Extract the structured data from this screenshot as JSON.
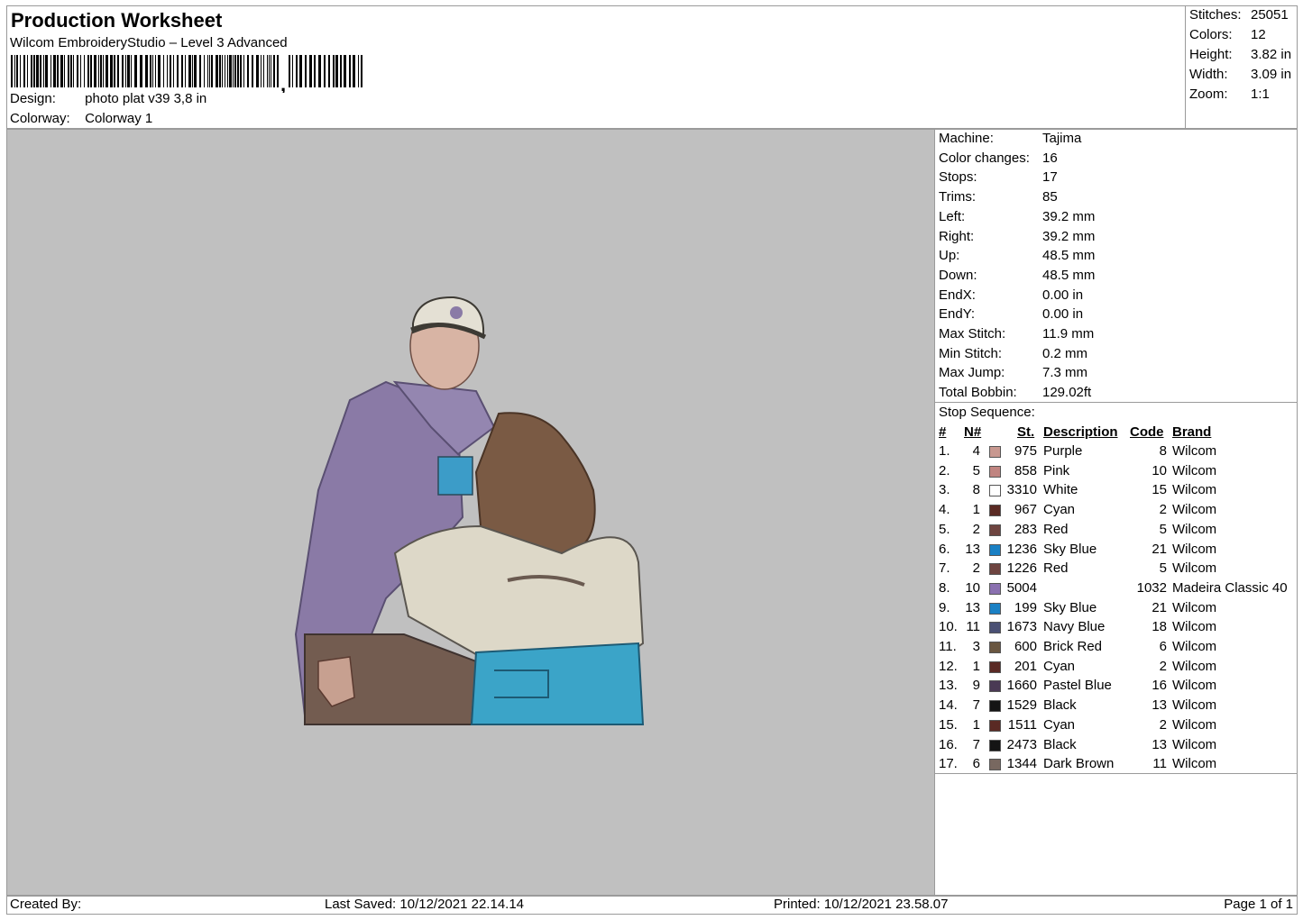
{
  "header": {
    "title": "Production Worksheet",
    "software": "Wilcom EmbroideryStudio – Level 3 Advanced",
    "design_label": "Design:",
    "design_value": "photo plat v39 3,8 in",
    "colorway_label": "Colorway:",
    "colorway_value": "Colorway 1"
  },
  "stats": [
    {
      "label": "Stitches:",
      "value": "25051"
    },
    {
      "label": "Colors:",
      "value": "12"
    },
    {
      "label": "Height:",
      "value": "3.82 in"
    },
    {
      "label": "Width:",
      "value": "3.09 in"
    },
    {
      "label": "Zoom:",
      "value": "1:1"
    }
  ],
  "machine_info": [
    {
      "label": "Machine:",
      "value": "Tajima"
    },
    {
      "label": "Color changes:",
      "value": "16"
    },
    {
      "label": "Stops:",
      "value": "17"
    },
    {
      "label": "Trims:",
      "value": "85"
    },
    {
      "label": "Left:",
      "value": "39.2 mm"
    },
    {
      "label": "Right:",
      "value": "39.2 mm"
    },
    {
      "label": "Up:",
      "value": "48.5 mm"
    },
    {
      "label": "Down:",
      "value": "48.5 mm"
    },
    {
      "label": "EndX:",
      "value": "0.00 in"
    },
    {
      "label": "EndY:",
      "value": "0.00 in"
    },
    {
      "label": "Max Stitch:",
      "value": "11.9 mm"
    },
    {
      "label": "Min Stitch:",
      "value": "0.2 mm"
    },
    {
      "label": "Max Jump:",
      "value": "7.3 mm"
    },
    {
      "label": "Total Bobbin:",
      "value": "129.02ft"
    }
  ],
  "stop_sequence": {
    "label": "Stop Sequence:",
    "headers": {
      "idx": "#",
      "n": "N#",
      "st": "St.",
      "desc": "Description",
      "code": "Code",
      "brand": "Brand"
    },
    "rows": [
      {
        "idx": "1.",
        "n": "4",
        "color": "#c89890",
        "st": "975",
        "desc": "Purple",
        "code": "8",
        "brand": "Wilcom"
      },
      {
        "idx": "2.",
        "n": "5",
        "color": "#c08480",
        "st": "858",
        "desc": "Pink",
        "code": "10",
        "brand": "Wilcom"
      },
      {
        "idx": "3.",
        "n": "8",
        "color": "#ffffff",
        "st": "3310",
        "desc": "White",
        "code": "15",
        "brand": "Wilcom"
      },
      {
        "idx": "4.",
        "n": "1",
        "color": "#5a2a24",
        "st": "967",
        "desc": "Cyan",
        "code": "2",
        "brand": "Wilcom"
      },
      {
        "idx": "5.",
        "n": "2",
        "color": "#6e4440",
        "st": "283",
        "desc": "Red",
        "code": "5",
        "brand": "Wilcom"
      },
      {
        "idx": "6.",
        "n": "13",
        "color": "#1a80c4",
        "st": "1236",
        "desc": "Sky Blue",
        "code": "21",
        "brand": "Wilcom"
      },
      {
        "idx": "7.",
        "n": "2",
        "color": "#6e4440",
        "st": "1226",
        "desc": "Red",
        "code": "5",
        "brand": "Wilcom"
      },
      {
        "idx": "8.",
        "n": "10",
        "color": "#8a70b0",
        "st": "5004",
        "desc": "",
        "code": "1032",
        "brand": "Madeira Classic 40"
      },
      {
        "idx": "9.",
        "n": "13",
        "color": "#1a80c4",
        "st": "199",
        "desc": "Sky Blue",
        "code": "21",
        "brand": "Wilcom"
      },
      {
        "idx": "10.",
        "n": "11",
        "color": "#4a5074",
        "st": "1673",
        "desc": "Navy Blue",
        "code": "18",
        "brand": "Wilcom"
      },
      {
        "idx": "11.",
        "n": "3",
        "color": "#6a5640",
        "st": "600",
        "desc": "Brick Red",
        "code": "6",
        "brand": "Wilcom"
      },
      {
        "idx": "12.",
        "n": "1",
        "color": "#5a2a24",
        "st": "201",
        "desc": "Cyan",
        "code": "2",
        "brand": "Wilcom"
      },
      {
        "idx": "13.",
        "n": "9",
        "color": "#4a3a54",
        "st": "1660",
        "desc": "Pastel Blue",
        "code": "16",
        "brand": "Wilcom"
      },
      {
        "idx": "14.",
        "n": "7",
        "color": "#141414",
        "st": "1529",
        "desc": "Black",
        "code": "13",
        "brand": "Wilcom"
      },
      {
        "idx": "15.",
        "n": "1",
        "color": "#5a2a24",
        "st": "1511",
        "desc": "Cyan",
        "code": "2",
        "brand": "Wilcom"
      },
      {
        "idx": "16.",
        "n": "7",
        "color": "#141414",
        "st": "2473",
        "desc": "Black",
        "code": "13",
        "brand": "Wilcom"
      },
      {
        "idx": "17.",
        "n": "6",
        "color": "#786860",
        "st": "1344",
        "desc": "Dark Brown",
        "code": "11",
        "brand": "Wilcom"
      }
    ]
  },
  "footer": {
    "created_by": "Created By:",
    "last_saved": "Last Saved: 10/12/2021 22.14.14",
    "printed": "Printed: 10/12/2021 23.58.07",
    "page": "Page 1 of 1"
  },
  "colors": {
    "canvas_bg": "#c0c0c0",
    "border": "#9a9a9a"
  }
}
